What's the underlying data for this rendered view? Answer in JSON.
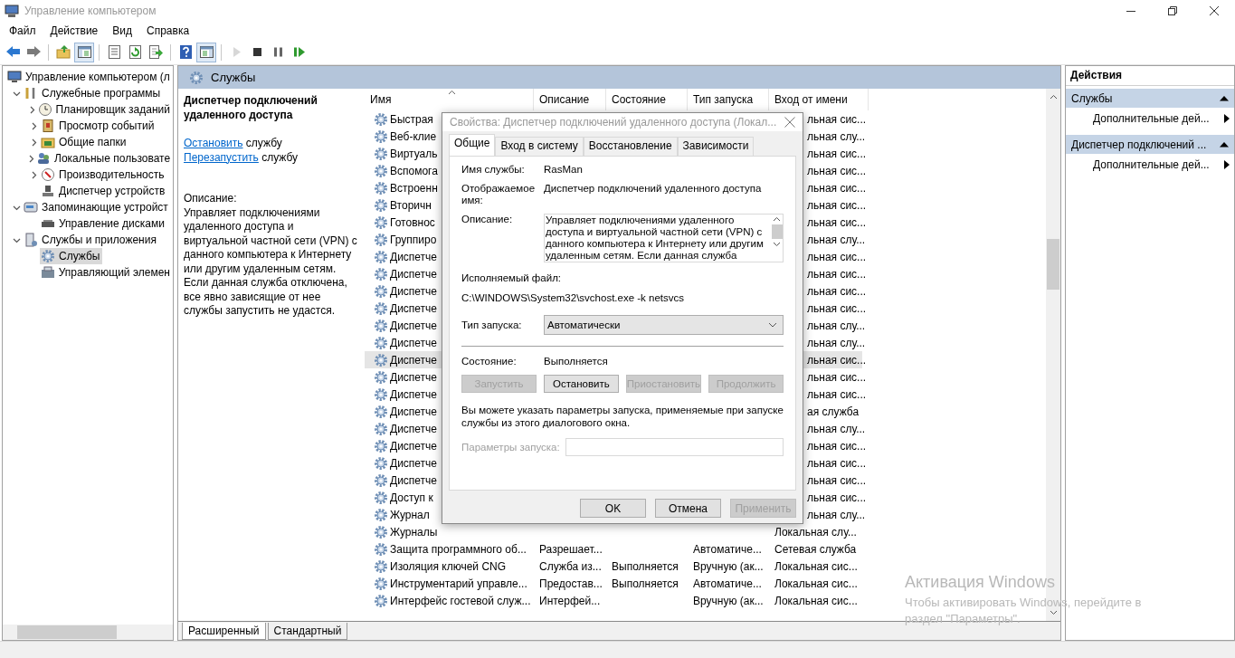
{
  "window": {
    "title": "Управление компьютером"
  },
  "menu": [
    "Файл",
    "Действие",
    "Вид",
    "Справка"
  ],
  "toolbar": [
    [
      {
        "kind": "back",
        "pressed": false,
        "disabled": false
      },
      {
        "kind": "forward",
        "pressed": false,
        "disabled": false
      }
    ],
    [
      {
        "kind": "up",
        "pressed": false,
        "disabled": false
      },
      {
        "kind": "tree",
        "pressed": true,
        "disabled": false
      }
    ],
    [
      {
        "kind": "properties",
        "pressed": false,
        "disabled": false
      },
      {
        "kind": "refresh",
        "pressed": false,
        "disabled": false
      },
      {
        "kind": "export",
        "pressed": false,
        "disabled": false
      }
    ],
    [
      {
        "kind": "help",
        "pressed": false,
        "disabled": false
      },
      {
        "kind": "action-pane",
        "pressed": true,
        "disabled": false
      }
    ],
    [
      {
        "kind": "play",
        "pressed": false,
        "disabled": true
      },
      {
        "kind": "stop",
        "pressed": false,
        "disabled": false
      },
      {
        "kind": "pause",
        "pressed": false,
        "disabled": false
      },
      {
        "kind": "resume",
        "pressed": false,
        "disabled": false
      }
    ]
  ],
  "tree": [
    {
      "label": "Управление компьютером (л",
      "selected": false,
      "children": [
        {
          "label": "Служебные программы",
          "expanded": true,
          "selected": false,
          "children": [
            {
              "label": "Планировщик заданий",
              "expanded": false,
              "selected": false
            },
            {
              "label": "Просмотр событий",
              "expanded": false,
              "selected": false
            },
            {
              "label": "Общие папки",
              "expanded": false,
              "selected": false
            },
            {
              "label": "Локальные пользовате",
              "expanded": false,
              "selected": false
            },
            {
              "label": "Производительность",
              "expanded": false,
              "selected": false
            },
            {
              "label": "Диспетчер устройств",
              "selected": false
            }
          ]
        },
        {
          "label": "Запоминающие устройст",
          "expanded": true,
          "selected": false,
          "children": [
            {
              "label": "Управление дисками",
              "selected": false
            }
          ]
        },
        {
          "label": "Службы и приложения",
          "expanded": true,
          "selected": false,
          "children": [
            {
              "label": "Службы",
              "selected": true
            },
            {
              "label": "Управляющий элемен",
              "selected": false
            }
          ]
        }
      ]
    }
  ],
  "services_panel": {
    "title": "Службы",
    "detail": {
      "name": "Диспетчер подключений удаленного доступа",
      "actions": [
        {
          "link": "Остановить",
          "rest": " службу"
        },
        {
          "link": "Перезапустить",
          "rest": " службу"
        }
      ],
      "description_label": "Описание:",
      "description": "Управляет подключениями удаленного доступа и виртуальной частной сети (VPN) с данного компьютера к Интернету или другим удаленным сетям. Если данная служба отключена, все явно зависящие от нее службы запустить не удастся."
    },
    "table": {
      "columns": [
        "Имя",
        "Описание",
        "Состояние",
        "Тип запуска",
        "Вход от имени"
      ],
      "rows": [
        {
          "kind": "partial",
          "name": "Быстрая",
          "login": "льная сис...",
          "selected": false
        },
        {
          "kind": "partial",
          "name": "Веб-клие",
          "login": "льная слу...",
          "selected": false
        },
        {
          "kind": "partial",
          "name": "Виртуаль",
          "login": "льная сис...",
          "selected": false
        },
        {
          "kind": "partial",
          "name": "Вспомога",
          "login": "льная сис...",
          "selected": false
        },
        {
          "kind": "partial",
          "name": "Встроенн",
          "login": "льная сис...",
          "selected": false
        },
        {
          "kind": "partial",
          "name": "Вторичн",
          "login": "льная сис...",
          "selected": false
        },
        {
          "kind": "partial",
          "name": "Готовнос",
          "login": "льная сис...",
          "selected": false
        },
        {
          "kind": "partial",
          "name": "Группиро",
          "login": "льная слу...",
          "selected": false
        },
        {
          "kind": "partial",
          "name": "Диспетче",
          "login": "льная сис...",
          "selected": false
        },
        {
          "kind": "partial",
          "name": "Диспетче",
          "login": "льная сис...",
          "selected": false
        },
        {
          "kind": "partial",
          "name": "Диспетче",
          "login": "льная сис...",
          "selected": false
        },
        {
          "kind": "partial",
          "name": "Диспетче",
          "login": "льная сис...",
          "selected": false
        },
        {
          "kind": "partial",
          "name": "Диспетче",
          "login": "льная слу...",
          "selected": false
        },
        {
          "kind": "partial",
          "name": "Диспетче",
          "login": "льная слу...",
          "selected": false
        },
        {
          "kind": "partial",
          "name": "Диспетче",
          "login": "льная сис...",
          "selected": true
        },
        {
          "kind": "partial",
          "name": "Диспетче",
          "login": "льная сис...",
          "selected": false
        },
        {
          "kind": "partial",
          "name": "Диспетче",
          "login": "льная сис...",
          "selected": false
        },
        {
          "kind": "partial",
          "name": "Диспетче",
          "login": "ая служба",
          "selected": false
        },
        {
          "kind": "partial",
          "name": "Диспетче",
          "login": "льная слу...",
          "selected": false
        },
        {
          "kind": "partial",
          "name": "Диспетче",
          "login": "льная сис...",
          "selected": false
        },
        {
          "kind": "partial",
          "name": "Диспетче",
          "login": "льная сис...",
          "selected": false
        },
        {
          "kind": "partial",
          "name": "Диспетче",
          "login": "льная сис...",
          "selected": false
        },
        {
          "kind": "partial",
          "name": "Доступ к",
          "login": "льная сис...",
          "selected": false
        },
        {
          "kind": "partial",
          "name": "Журнал",
          "login": "льная слу...",
          "selected": false
        },
        {
          "kind": "full",
          "name": "Журналы",
          "login": "Локальная слу...",
          "selected": false
        },
        {
          "kind": "full",
          "name": "Защита программного об...",
          "description": "Разрешает...",
          "startup": "Автоматиче...",
          "login": "Сетевая служба",
          "selected": false
        },
        {
          "kind": "full",
          "name": "Изоляция ключей CNG",
          "description": "Служба из...",
          "status": "Выполняется",
          "startup": "Вручную (ак...",
          "login": "Локальная сис...",
          "selected": false
        },
        {
          "kind": "full",
          "name": "Инструментарий управле...",
          "description": "Предостав...",
          "status": "Выполняется",
          "startup": "Автоматиче...",
          "login": "Локальная сис...",
          "selected": false
        },
        {
          "kind": "full",
          "name": "Интерфейс гостевой служ...",
          "description": "Интерфей...",
          "startup": "Вручную (ак...",
          "login": "Локальная сис...",
          "selected": false
        }
      ]
    },
    "view_tabs": [
      {
        "label": "Расширенный",
        "selected": true
      },
      {
        "label": "Стандартный",
        "selected": false
      }
    ]
  },
  "dialog": {
    "title": "Свойства: Диспетчер подключений удаленного доступа (Локал...",
    "tabs": [
      {
        "label": "Общие",
        "selected": true
      },
      {
        "label": "Вход в систему",
        "selected": false
      },
      {
        "label": "Восстановление",
        "selected": false
      },
      {
        "label": "Зависимости",
        "selected": false
      }
    ],
    "service_name_label": "Имя службы:",
    "service_name": "RasMan",
    "display_name_label": "Отображаемое имя:",
    "display_name": "Диспетчер подключений удаленного доступа",
    "description_label": "Описание:",
    "description": "Управляет подключениями удаленного доступа и виртуальной частной сети (VPN) с данного компьютера к Интернету или другим удаленным сетям. Если данная служба",
    "executable_label": "Исполняемый файл:",
    "executable": "C:\\WINDOWS\\System32\\svchost.exe -k netsvcs",
    "startup_label": "Тип запуска:",
    "startup": "Автоматически",
    "status_label": "Состояние:",
    "status": "Выполняется",
    "service_buttons": [
      {
        "label": "Запустить",
        "disabled": true
      },
      {
        "label": "Остановить",
        "disabled": false
      },
      {
        "label": "Приостановить",
        "disabled": true
      },
      {
        "label": "Продолжить",
        "disabled": true
      }
    ],
    "hint": "Вы можете указать параметры запуска, применяемые при запуске службы из этого диалогового окна.",
    "params": {
      "label": "Параметры запуска:",
      "disabled": true
    },
    "buttons": [
      {
        "label": "OK",
        "disabled": false
      },
      {
        "label": "Отмена",
        "disabled": false
      },
      {
        "label": "Применить",
        "disabled": true
      }
    ]
  },
  "actions_pane": {
    "title": "Действия",
    "sections": [
      {
        "title": "Службы",
        "expanded": true,
        "items": [
          "Дополнительные дей..."
        ]
      },
      {
        "title": "Диспетчер подключений ...",
        "expanded": true,
        "items": [
          "Дополнительные дей..."
        ]
      }
    ]
  },
  "activation": {
    "title": "Активация Windows",
    "lines": [
      "Чтобы активировать Windows, перейдите в",
      "раздел \"Параметры\"."
    ]
  }
}
